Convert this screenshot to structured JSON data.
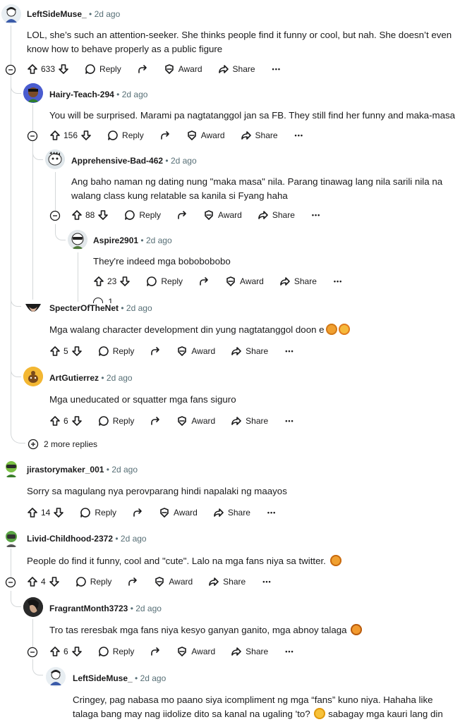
{
  "comments": [
    {
      "author": "LeftSideMuse_",
      "time": "2d ago",
      "line1": "LOL, she’s such an attention-seeker. She thinks people find it funny or cool, but nah. She doesn’t even",
      "line2": "know how to behave properly as a public figure",
      "score": "633"
    },
    {
      "author": "Hairy-Teach-294",
      "time": "2d ago",
      "line1": "You will be surprised. Marami pa nagtatanggol jan sa FB. They still find her funny and maka-masa",
      "score": "156"
    },
    {
      "author": "Apprehensive-Bad-462",
      "time": "2d ago",
      "line1": "Ang baho naman ng dating nung \"maka masa\" nila. Parang tinawag lang nila sarili nila na",
      "line2": "walang class kung relatable sa kanila si Fyang haha",
      "score": "88"
    },
    {
      "author": "Aspire2901",
      "time": "2d ago",
      "line1": "They're indeed mga bobobobobo",
      "score": "23"
    },
    {
      "author": "SpecterOfTheNet",
      "time": "2d ago",
      "line1": "Mga walang character development din yung nagtatanggol doon e",
      "score": "5"
    },
    {
      "author": "ArtGutierrez",
      "time": "2d ago",
      "line1": "Mga uneducated or squatter mga fans siguro",
      "score": "6"
    },
    {
      "author": "jirastorymaker_001",
      "time": "2d ago",
      "line1": "Sorry sa magulang nya perovparang hindi napalaki ng maayos",
      "score": "14"
    },
    {
      "author": "Livid-Childhood-2372",
      "time": "2d ago",
      "line1": "People do find it funny, cool and \"cute\". Lalo na mga fans niya sa twitter.",
      "score": "4"
    },
    {
      "author": "FragrantMonth3723",
      "time": "2d ago",
      "line1": "Tro tas reresbak mga fans niya kesyo ganyan ganito, mga abnoy talaga",
      "score": "6"
    },
    {
      "author": "LeftSideMuse_",
      "time": "2d ago",
      "line1": "Cringey, pag nabasa mo paano siya icompliment ng mga “fans” kuno niya. Hahaha like",
      "line2": "talaga bang may nag iidolize dito sa kanal na ugaling 'to?",
      "line2b": "sabagay mga kauri lang din"
    }
  ],
  "labels": {
    "reply": "Reply",
    "award": "Award",
    "share": "Share",
    "more": "•••",
    "sep": "•"
  },
  "more_replies": "2 more replies",
  "hidden_count": "1",
  "colors": {
    "thread": "#d4d7d9",
    "meta": "#576f76",
    "text": "#1a1a1b"
  }
}
